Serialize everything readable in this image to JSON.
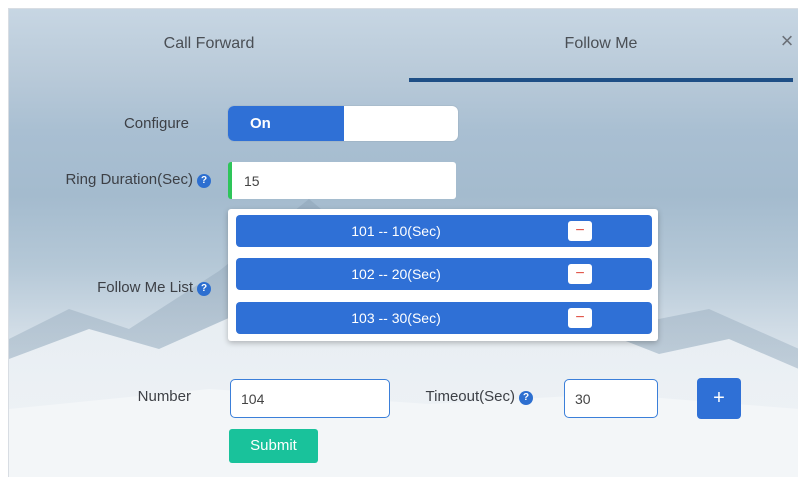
{
  "tabs": {
    "call_forward": "Call Forward",
    "follow_me": "Follow Me",
    "active": "Follow Me"
  },
  "close_symbol": "×",
  "configure": {
    "label": "Configure",
    "toggle_value": "On"
  },
  "ring_duration": {
    "label": "Ring Duration(Sec)",
    "value": "15"
  },
  "follow_me_list": {
    "label": "Follow Me List",
    "items": [
      {
        "text": "101 -- 10(Sec)",
        "remove": "−"
      },
      {
        "text": "102 -- 20(Sec)",
        "remove": "−"
      },
      {
        "text": "103 -- 30(Sec)",
        "remove": "−"
      }
    ]
  },
  "number": {
    "label": "Number",
    "value": "104"
  },
  "timeout": {
    "label": "Timeout(Sec)",
    "value": "30"
  },
  "add_symbol": "+",
  "submit_label": "Submit",
  "help_symbol": "?",
  "colors": {
    "accent_blue": "#2f70d6",
    "tab_underline": "#1f4f86",
    "ring_border": "#2ec55a",
    "submit_green": "#19c29b",
    "remove_red": "#e2564a"
  }
}
